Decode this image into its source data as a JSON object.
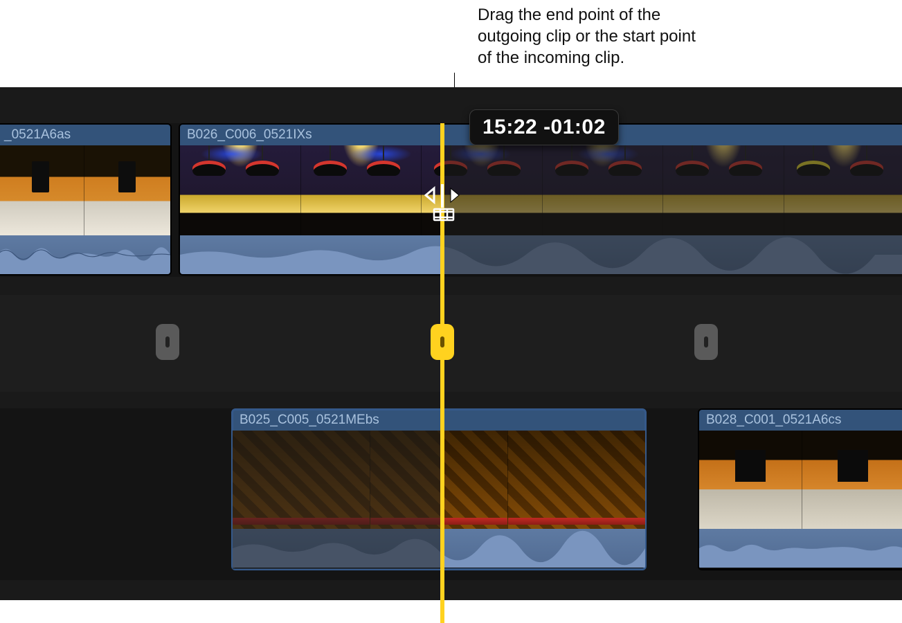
{
  "annotation": {
    "text": "Drag the end point of the outgoing clip or the start point of the incoming clip."
  },
  "timecode": {
    "position": "15:22",
    "offset": "-01:02",
    "display": "15:22  -01:02"
  },
  "clips": {
    "primary_left": {
      "name": "_0521A6as"
    },
    "primary_right": {
      "name": "B026_C006_0521IXs"
    },
    "angle_left": {
      "name": "B025_C005_0521MEbs"
    },
    "angle_right": {
      "name": "B028_C001_0521A6cs"
    }
  },
  "icons": {
    "trim_cursor": "trim-edit-cursor"
  }
}
